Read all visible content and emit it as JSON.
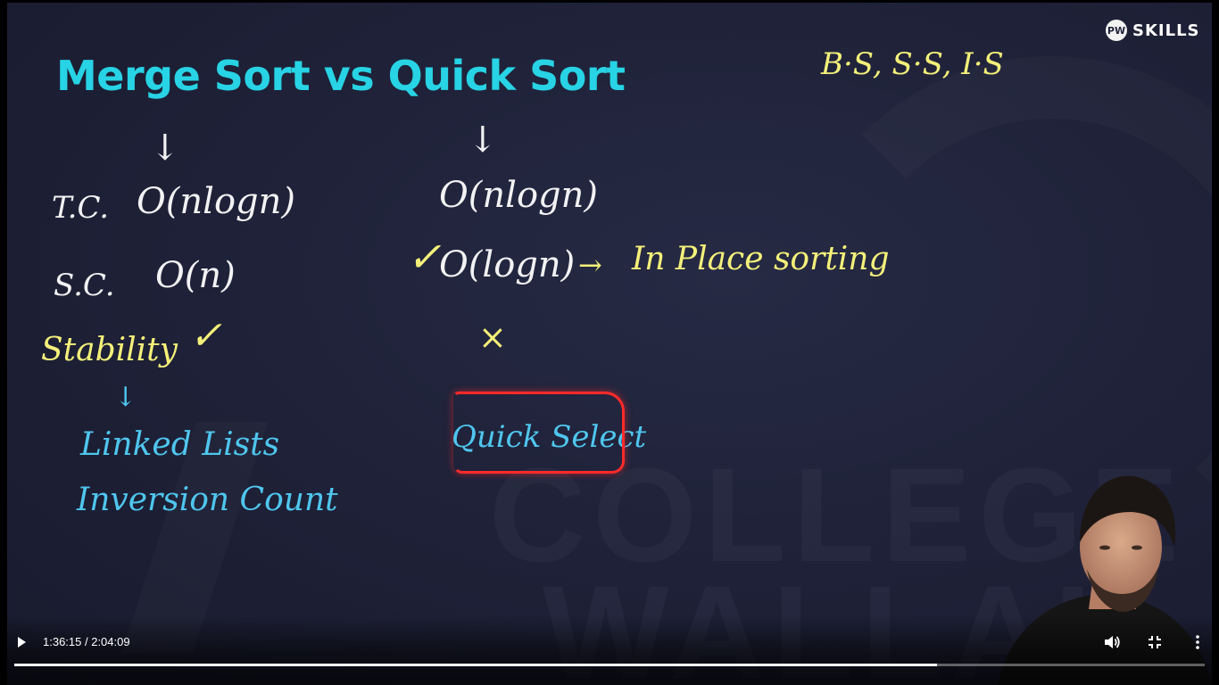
{
  "slide": {
    "title": "Merge Sort vs Quick Sort",
    "logo_text": "SKILLS",
    "top_right_note": "B·S, S·S, I·S",
    "merge_sort": {
      "arrow": "↓",
      "tc_label": "T.C.",
      "tc_value": "O(nlogn)",
      "sc_label": "S.C.",
      "sc_value": "O(n)",
      "stability": "Stability",
      "stability_mark": "✓",
      "sub_arrow": "↓",
      "apps": [
        "Linked Lists",
        "Inversion Count"
      ]
    },
    "quick_sort": {
      "arrow": "↓",
      "tc_value": "O(nlogn)",
      "sc_check": "✓",
      "sc_value": "O(logn)",
      "in_place_arrow": "→",
      "in_place": "In Place sorting",
      "stability_mark": "×",
      "app": "Quick Select"
    },
    "watermark": [
      "COLLEGE",
      "WALLAH"
    ]
  },
  "player": {
    "current_time": "1:36:15",
    "separator": " / ",
    "duration": "2:04:09",
    "progress": 0.775,
    "icons": {
      "play": "play-icon",
      "volume": "volume-icon",
      "exit_fullscreen": "exit-fullscreen-icon",
      "more": "more-vert-icon"
    }
  },
  "colors": {
    "title": "#27d3e4",
    "chalk_white": "#f2f2f4",
    "chalk_yellow": "#f4f07a",
    "chalk_blue": "#4fc6ee",
    "highlight_red": "#ff2a2a",
    "background": "#1f2239"
  }
}
